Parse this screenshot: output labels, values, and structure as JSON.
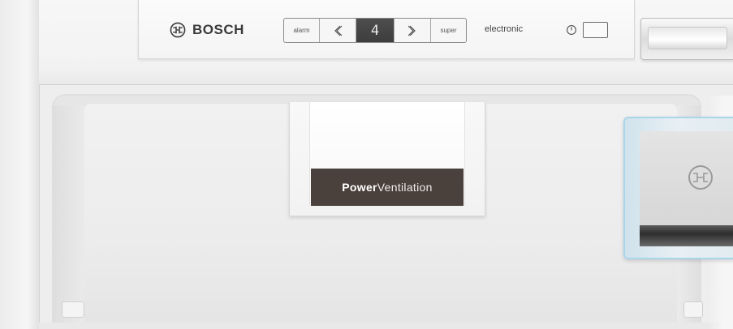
{
  "brand": {
    "name": "BOSCH",
    "logo_icon": "bosch-armature-icon"
  },
  "control_panel": {
    "buttons": {
      "alarm_label": "alarm",
      "decrease_icon": "chevron-left-icon",
      "increase_icon": "chevron-right-icon",
      "super_label": "super"
    },
    "display_value": "4",
    "mode_label": "electronic",
    "power_icon": "power-icon"
  },
  "ventilation": {
    "label_bold": "Power",
    "label_light": "Ventilation"
  },
  "colors": {
    "label_background": "#4a403c",
    "display_background": "#444444",
    "bin_trim": "#a9d6ea"
  }
}
